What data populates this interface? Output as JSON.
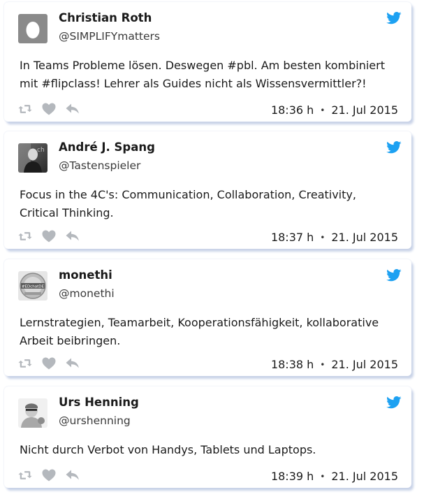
{
  "colors": {
    "twitter_blue": "#1da1f2",
    "action_grey": "#b4b8bd",
    "card_shadow": "#c9d3e8"
  },
  "tweets": [
    {
      "name": "Christian Roth",
      "handle": "@SIMPLIFYmatters",
      "text": "In Teams Probleme lösen. Deswegen #pbl. Am besten kombiniert mit #flipclass! Lehrer als Guides nicht als Wissensvermittler?!",
      "time": "18:36 h",
      "separator": "•",
      "date": "21. Jul 2015",
      "avatar_icon": "default-egg-avatar"
    },
    {
      "name": "André J. Spang",
      "handle": "@Tastenspieler",
      "text": "Focus in the 4C's: Communication, Collaboration, Creativity, Critical Thinking.",
      "time": "18:37 h",
      "separator": "•",
      "date": "21. Jul 2015",
      "avatar_icon": "photo-avatar"
    },
    {
      "name": "monethi",
      "handle": "@monethi",
      "text": "Lernstrategien, Teamarbeit, Kooperationsfähigkeit, kollaborative Arbeit beibringen.",
      "time": "18:38 h",
      "separator": "•",
      "date": "21. Jul 2015",
      "avatar_icon": "badge-avatar",
      "avatar_text": "#EDchatDE"
    },
    {
      "name": "Urs Henning",
      "handle": "@urshenning",
      "text": "Nicht durch Verbot von Handys, Tablets und Laptops.",
      "time": "18:39 h",
      "separator": "•",
      "date": "21. Jul 2015",
      "avatar_icon": "photo-avatar"
    }
  ],
  "actions": [
    "retweet-icon",
    "like-icon",
    "reply-icon"
  ]
}
